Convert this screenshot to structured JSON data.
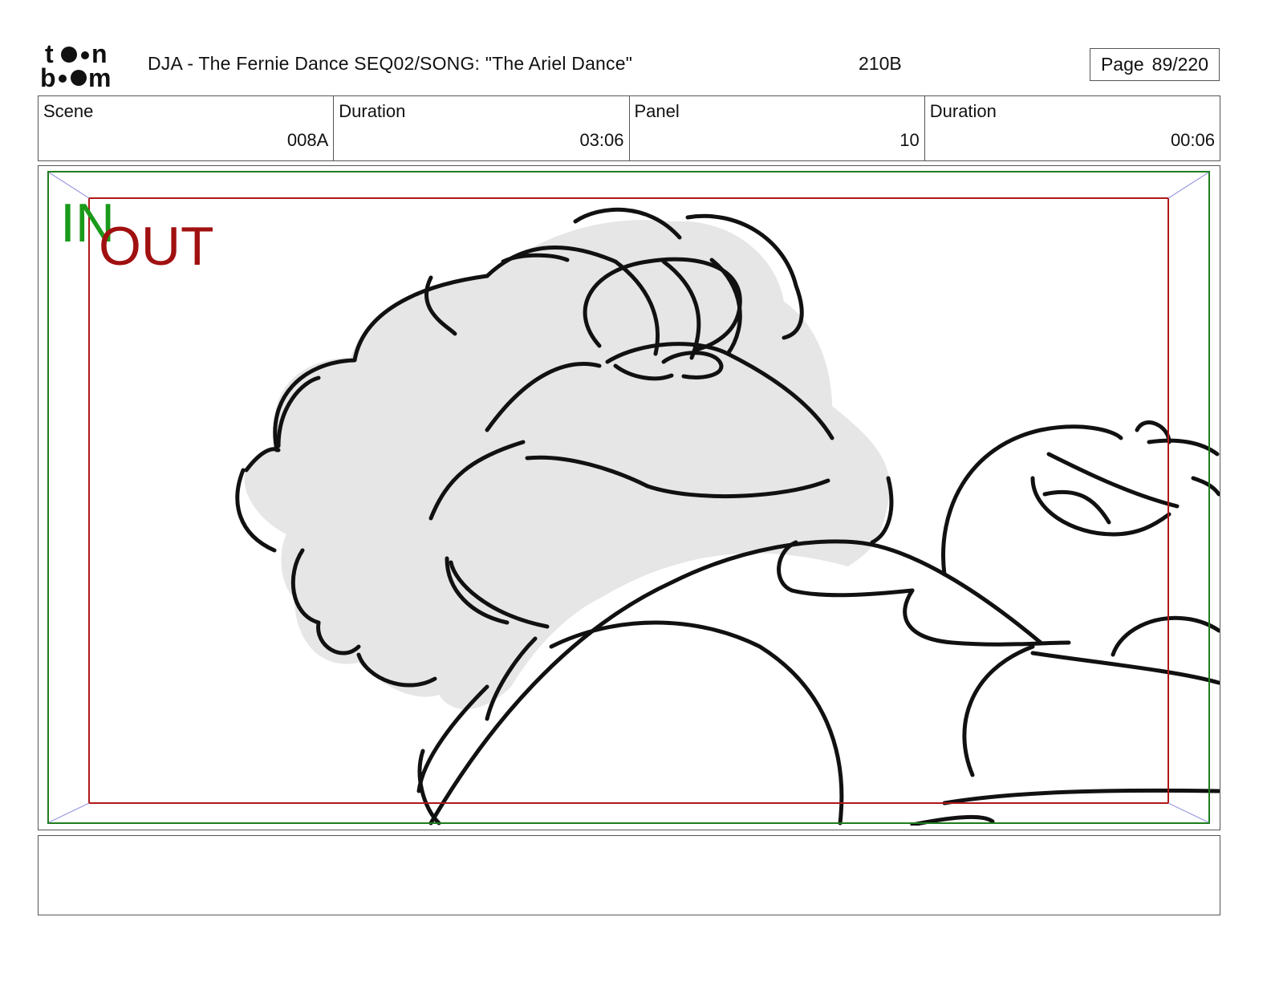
{
  "header": {
    "logo_text": "toon boom",
    "project_title": "DJA - The Fernie Dance  SEQ02/SONG: \"The Ariel Dance\"",
    "page_code": "210B",
    "page_label": "Page",
    "page_number": "89/220"
  },
  "info": {
    "scene_label": "Scene",
    "scene_value": "008A",
    "scene_duration_label": "Duration",
    "scene_duration_value": "03:06",
    "panel_label": "Panel",
    "panel_value": "10",
    "panel_duration_label": "Duration",
    "panel_duration_value": "00:06"
  },
  "panel": {
    "in_label": "IN",
    "out_label": "OUT",
    "in_color": "#1a9a1a",
    "out_color": "#a11010"
  },
  "caption": {
    "text": ""
  }
}
